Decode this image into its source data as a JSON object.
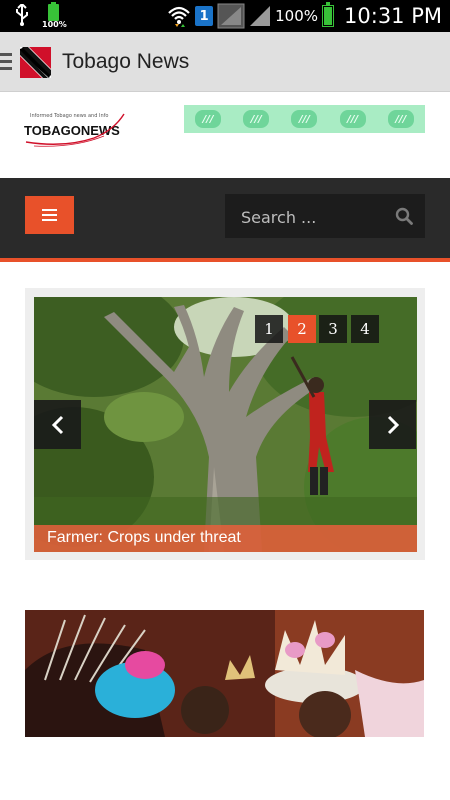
{
  "status_bar": {
    "small_battery_label": "100%",
    "sim_label": "1",
    "battery_percent": "100%",
    "time": "10:31 PM",
    "icons": [
      "usb-icon",
      "battery-icon",
      "wifi-icon",
      "sim-icon",
      "signal-icon"
    ]
  },
  "app_bar": {
    "title": "Tobago News"
  },
  "site": {
    "logo_small_text": "Informed Tobago news and Info",
    "logo_text": "TOBAGONEWS"
  },
  "ad_banner": {
    "marks": [
      "///",
      "///",
      "///",
      "///",
      "///"
    ]
  },
  "navbar": {
    "search_placeholder": "Search ..."
  },
  "slider": {
    "pages": [
      "1",
      "2",
      "3",
      "4"
    ],
    "active_page": "2",
    "caption": "Farmer: Crops under threat"
  },
  "colors": {
    "accent": "#e8512a",
    "navbar": "#2a2a2a",
    "appbar": "#e0e0e0",
    "ad_green": "#a9ecc4"
  }
}
